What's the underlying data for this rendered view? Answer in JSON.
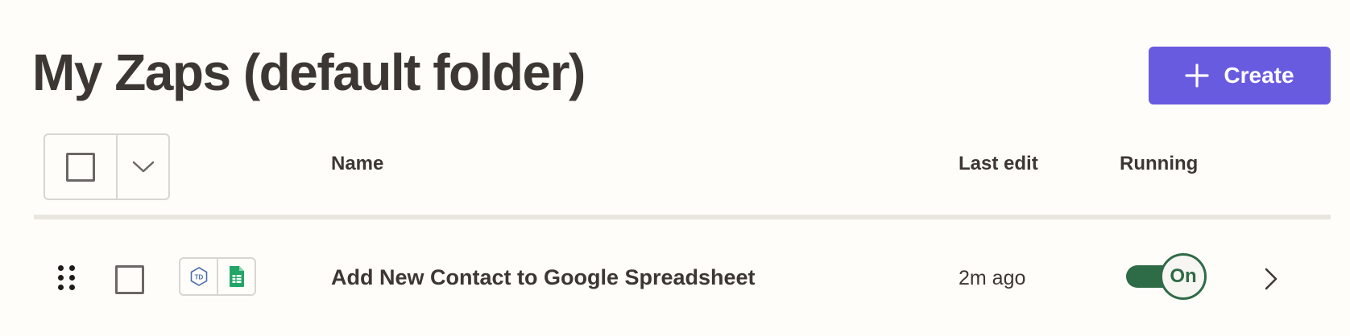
{
  "header": {
    "title": "My Zaps (default folder)",
    "create_label": "Create"
  },
  "table": {
    "columns": {
      "name": "Name",
      "last_edit": "Last edit",
      "running": "Running"
    },
    "rows": [
      {
        "name": "Add New Contact to Google Spreadsheet",
        "last_edit": "2m ago",
        "running": "On",
        "apps": [
          "TD",
          "google-sheets-icon"
        ]
      }
    ]
  },
  "colors": {
    "primary": "#695be0",
    "toggle_on": "#2e6b47",
    "text": "#3d3733",
    "background": "#fffdf9"
  }
}
